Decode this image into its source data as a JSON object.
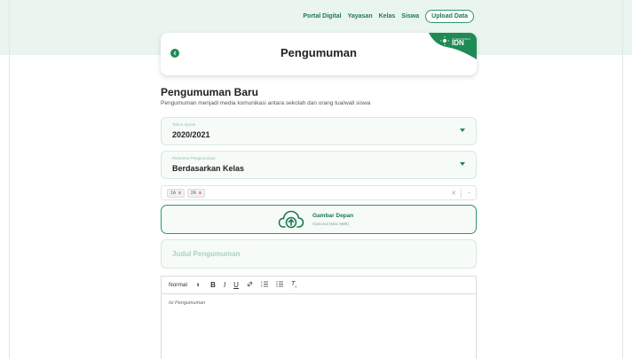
{
  "nav": {
    "links": [
      "Portal Digital",
      "Yayasan",
      "Kelas",
      "Siswa"
    ],
    "upload_label": "Upload Data"
  },
  "header": {
    "title": "Pengumuman",
    "badge_text": "IDN",
    "brand_color": "#1f8a55"
  },
  "page": {
    "title": "Pengumuman Baru",
    "subtitle": "Pengumuman menjadi media komunikasi antara sekolah dan orang tua/wali siswa"
  },
  "form": {
    "tahun_ajaran": {
      "label": "Tahun Ajaran",
      "value": "2020/2021"
    },
    "penerima": {
      "label": "Penerima Pengumuman",
      "value": "Berdasarkan Kelas"
    },
    "kelas_tags": [
      "1A",
      "2A"
    ],
    "upload": {
      "title": "Gambar Depan",
      "subtitle": "Opsional (Max 5MB)"
    },
    "judul_placeholder": "Judul Pengumuman",
    "editor": {
      "font_size": "Normal",
      "body_placeholder": "Isi Pengumuman"
    }
  },
  "icons": {
    "back": "chevron-left-icon",
    "upload": "cloud-upload-icon",
    "caret": "caret-down-icon"
  }
}
